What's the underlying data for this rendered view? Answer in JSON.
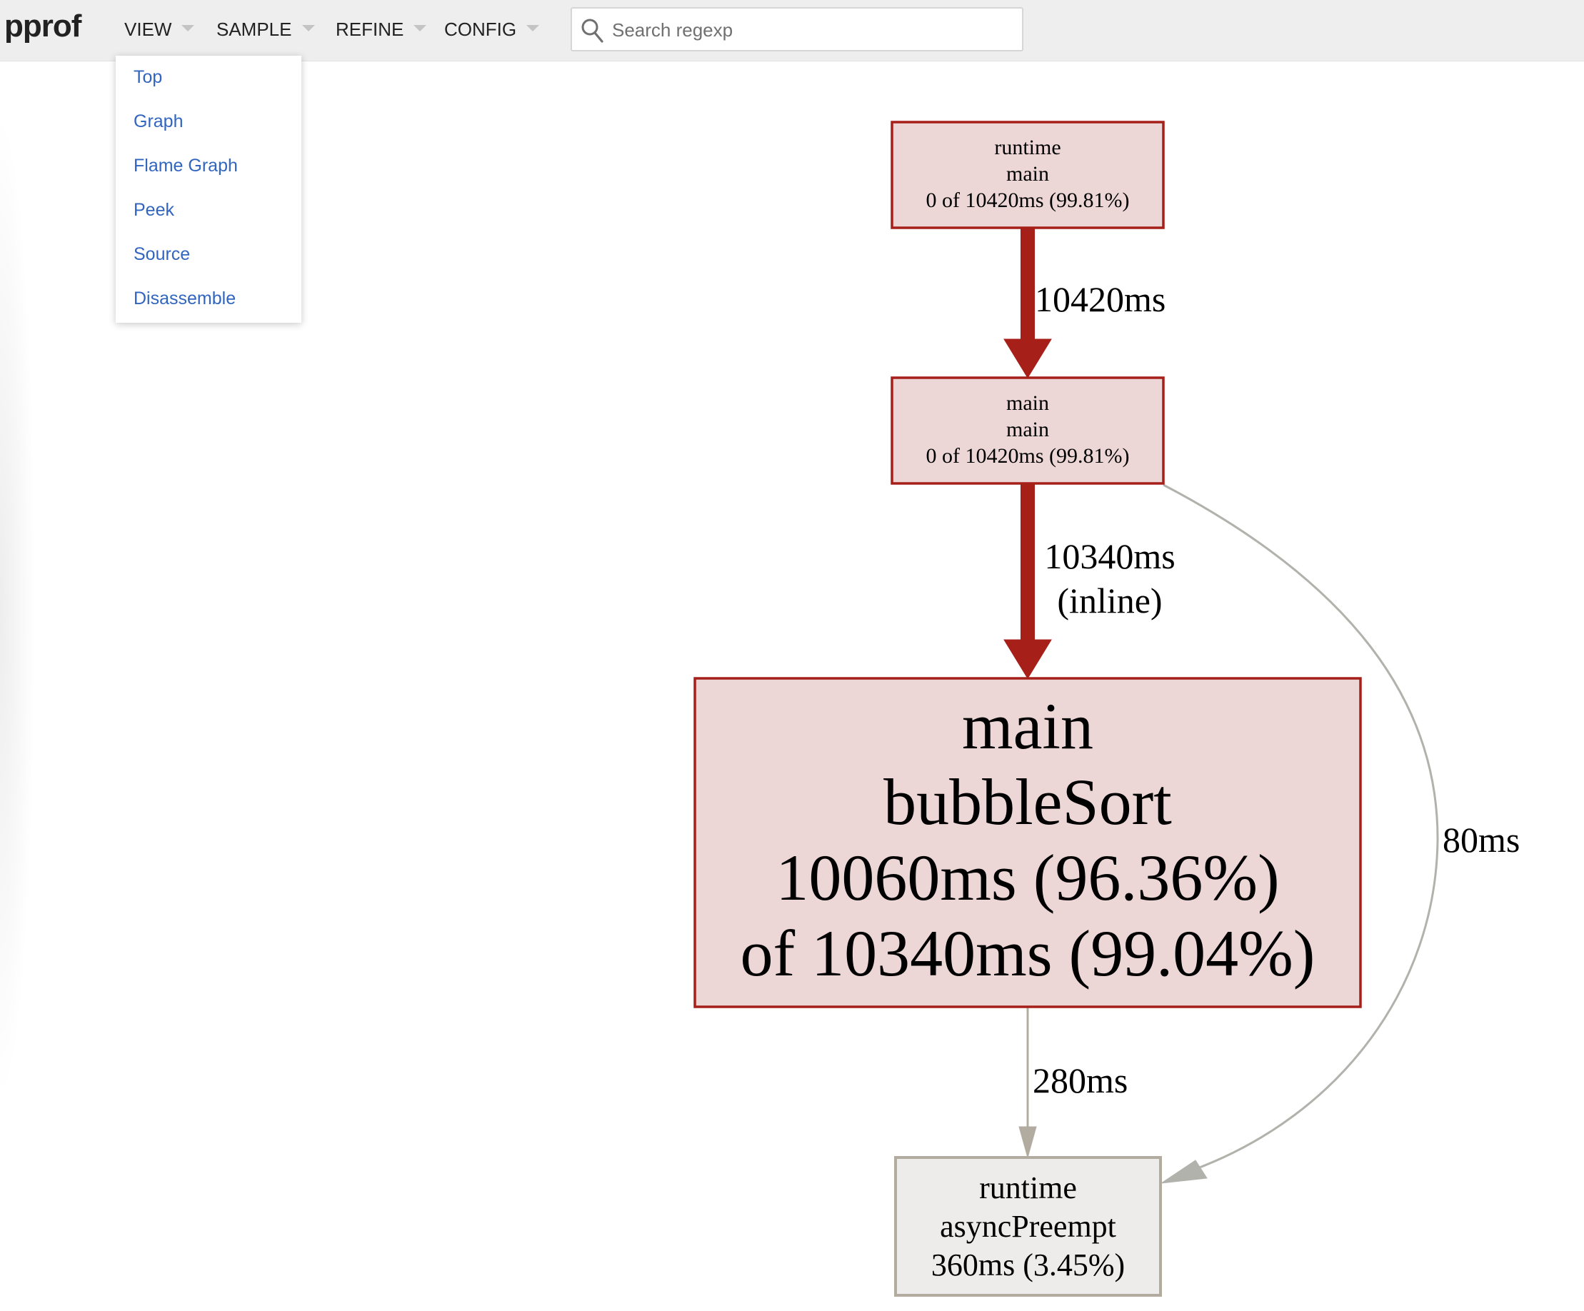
{
  "app": {
    "logo": "pprof"
  },
  "toolbar": {
    "menus": [
      {
        "label": "VIEW"
      },
      {
        "label": "SAMPLE"
      },
      {
        "label": "REFINE"
      },
      {
        "label": "CONFIG"
      }
    ],
    "search": {
      "placeholder": "Search regexp",
      "value": "",
      "icon": "search-icon"
    }
  },
  "view_menu": {
    "open": true,
    "items": [
      {
        "label": "Top"
      },
      {
        "label": "Graph"
      },
      {
        "label": "Flame Graph"
      },
      {
        "label": "Peek"
      },
      {
        "label": "Source"
      },
      {
        "label": "Disassemble"
      }
    ]
  },
  "colors": {
    "hot_stroke": "#a61f18",
    "hot_fill": "#edd6d6",
    "cold_stroke": "#b2aca0",
    "cold_fill": "#edeceb",
    "link": "#3165bf",
    "toolbar_bg": "#eeeeee"
  },
  "graph": {
    "nodes": [
      {
        "id": "runtime.main",
        "lines": [
          "runtime",
          "main",
          "0 of 10420ms (99.81%)"
        ],
        "package": "runtime",
        "function": "main",
        "flat_ms": 0,
        "cum_ms": 10420,
        "cum_pct": 99.81,
        "style": "hot"
      },
      {
        "id": "main.main",
        "lines": [
          "main",
          "main",
          "0 of 10420ms (99.81%)"
        ],
        "package": "main",
        "function": "main",
        "flat_ms": 0,
        "cum_ms": 10420,
        "cum_pct": 99.81,
        "style": "hot"
      },
      {
        "id": "main.bubbleSort",
        "lines": [
          "main",
          "bubbleSort",
          "10060ms (96.36%)",
          "of 10340ms (99.04%)"
        ],
        "package": "main",
        "function": "bubbleSort",
        "flat_ms": 10060,
        "flat_pct": 96.36,
        "cum_ms": 10340,
        "cum_pct": 99.04,
        "style": "hot"
      },
      {
        "id": "runtime.asyncPreempt",
        "lines": [
          "runtime",
          "asyncPreempt",
          "360ms (3.45%)"
        ],
        "package": "runtime",
        "function": "asyncPreempt",
        "flat_ms": 360,
        "flat_pct": 3.45,
        "cum_ms": 360,
        "style": "cold"
      }
    ],
    "edges": [
      {
        "from": "runtime.main",
        "to": "main.main",
        "label_lines": [
          "10420ms"
        ],
        "value_ms": 10420,
        "style": "hot"
      },
      {
        "from": "main.main",
        "to": "main.bubbleSort",
        "label_lines": [
          "10340ms",
          "(inline)"
        ],
        "value_ms": 10340,
        "inline": true,
        "style": "hot"
      },
      {
        "from": "main.bubbleSort",
        "to": "runtime.asyncPreempt",
        "label_lines": [
          "280ms"
        ],
        "value_ms": 280,
        "style": "cold"
      },
      {
        "from": "main.main",
        "to": "runtime.asyncPreempt",
        "label_lines": [
          "80ms"
        ],
        "value_ms": 80,
        "style": "cold"
      }
    ]
  }
}
